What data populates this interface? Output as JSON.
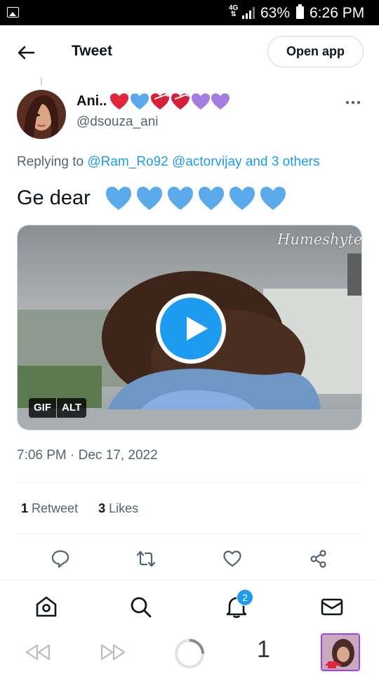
{
  "status_bar": {
    "network": "4G",
    "battery_percent": "63%",
    "time": "6:26 PM"
  },
  "header": {
    "title": "Tweet",
    "open_app_label": "Open app"
  },
  "tweet": {
    "author_name": "Ani..",
    "author_emojis": [
      "red-heart",
      "blue-heart",
      "heart-with-ribbon",
      "heart-with-ribbon",
      "purple-heart",
      "purple-heart"
    ],
    "author_handle": "@dsouza_ani",
    "replying_to_prefix": "Replying to ",
    "replying_to_users": [
      "@Ram_Ro92",
      "@actorvijay"
    ],
    "replying_to_others": "and 3 others",
    "text": "Ge dear",
    "text_emojis": [
      "blue-heart",
      "blue-heart",
      "blue-heart",
      "blue-heart",
      "blue-heart",
      "blue-heart"
    ],
    "media": {
      "watermark": "Humeshyte",
      "gif_badge": "GIF",
      "alt_badge": "ALT"
    },
    "timestamp": "7:06 PM · Dec 17, 2022",
    "retweet_count": "1",
    "retweet_label": "Retweet",
    "likes_count": "3",
    "likes_label": "Likes"
  },
  "actions": [
    "reply-icon",
    "retweet-icon",
    "like-icon",
    "share-icon"
  ],
  "bottom_nav": {
    "items": [
      "home-icon",
      "search-icon",
      "notifications-icon",
      "messages-icon"
    ],
    "notification_count": "2"
  },
  "browser_bar": {
    "tab_count": "1"
  },
  "colors": {
    "accent": "#1d9bf0",
    "secondary_text": "#536471",
    "blue_heart": "#5aa9ea",
    "purple_heart": "#a57ce0",
    "red_heart": "#e0263a"
  }
}
